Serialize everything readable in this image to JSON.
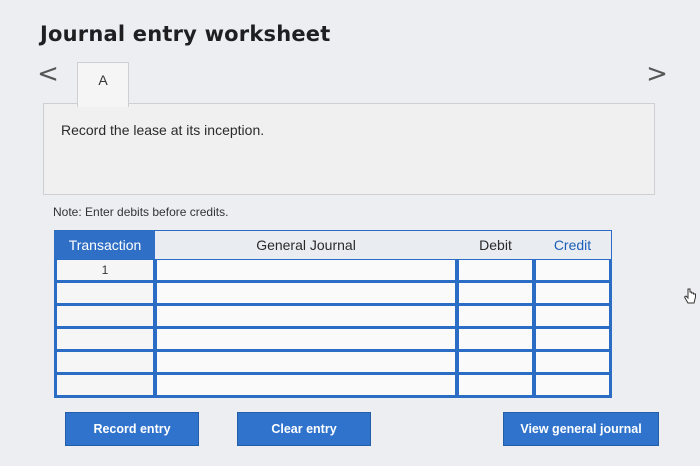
{
  "page": {
    "title": "Journal entry worksheet"
  },
  "nav": {
    "prev": "<",
    "next": ">"
  },
  "tabs": [
    {
      "label": "A"
    }
  ],
  "panel": {
    "instruction": "Record the lease at its inception."
  },
  "note": "Note: Enter debits before credits.",
  "table": {
    "headers": {
      "transaction": "Transaction",
      "journal": "General Journal",
      "debit": "Debit",
      "credit": "Credit"
    },
    "rows": [
      {
        "transaction": "1",
        "journal": "",
        "debit": "",
        "credit": ""
      },
      {
        "transaction": "",
        "journal": "",
        "debit": "",
        "credit": ""
      },
      {
        "transaction": "",
        "journal": "",
        "debit": "",
        "credit": ""
      },
      {
        "transaction": "",
        "journal": "",
        "debit": "",
        "credit": ""
      },
      {
        "transaction": "",
        "journal": "",
        "debit": "",
        "credit": ""
      },
      {
        "transaction": "",
        "journal": "",
        "debit": "",
        "credit": ""
      }
    ]
  },
  "buttons": {
    "record": "Record entry",
    "clear": "Clear entry",
    "view": "View general journal"
  },
  "colors": {
    "accent": "#2f73cc",
    "background": "#eceef2"
  },
  "icons": {
    "cursor": "hand-pointer-icon"
  }
}
